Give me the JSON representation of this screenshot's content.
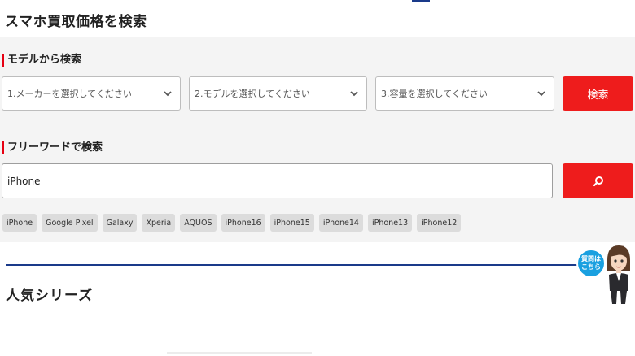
{
  "page": {
    "title": "スマホ買取価格を検索"
  },
  "model_search": {
    "heading": "モデルから検索",
    "maker_placeholder": "1.メーカーを選択してください",
    "model_placeholder": "2.モデルを選択してください",
    "capacity_placeholder": "3.容量を選択してください",
    "search_button": "検索"
  },
  "free_word": {
    "heading": "フリーワードで検索",
    "value": "iPhone"
  },
  "chips": [
    "iPhone",
    "Google Pixel",
    "Galaxy",
    "Xperia",
    "AQUOS",
    "iPhone16",
    "iPhone15",
    "iPhone14",
    "iPhone13",
    "iPhone12"
  ],
  "popular": {
    "title": "人気シリーズ"
  },
  "help": {
    "bubble_text": "質問は\nこちら"
  },
  "colors": {
    "accent_red": "#ee1c1c",
    "navy": "#1a3a8a",
    "help_blue": "#1aa0e0"
  },
  "icons": {
    "select_arrow": "chevron-down-icon",
    "search": "search-icon"
  }
}
